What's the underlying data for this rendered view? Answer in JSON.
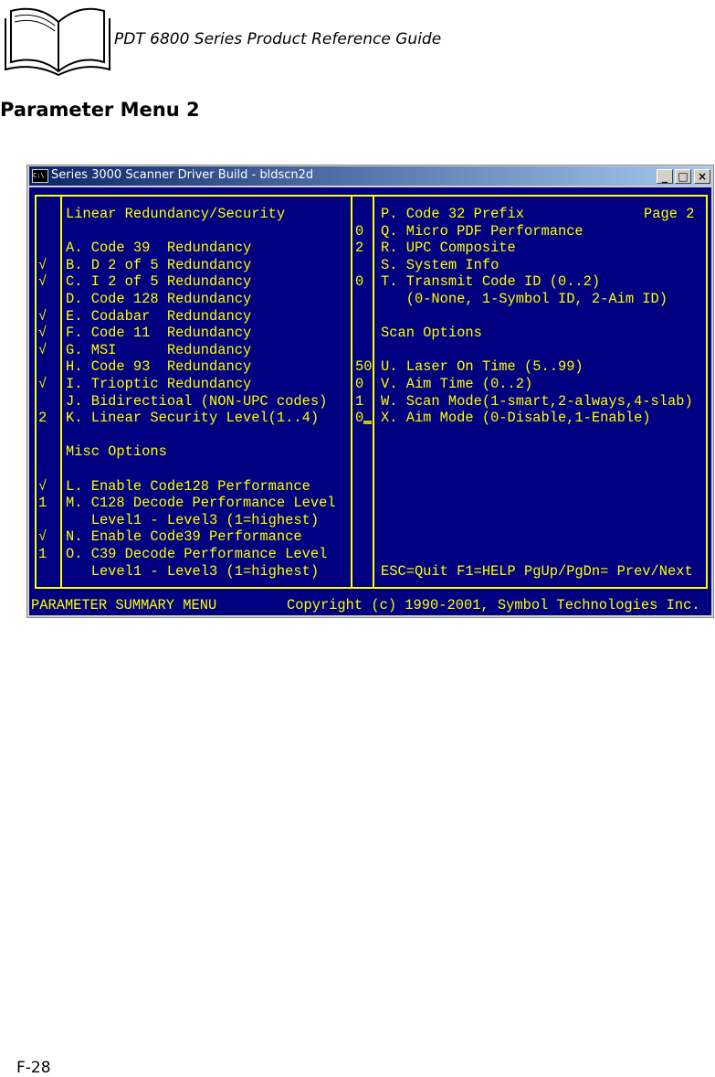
{
  "page": {
    "header": "PDT 6800 Series Product Reference Guide",
    "section_title": "Parameter Menu 2",
    "page_number": "F-28"
  },
  "window": {
    "title": "Series 3000 Scanner Driver Build - bldscn2d",
    "icon_label": "C:\\",
    "buttons": {
      "minimize": "_",
      "maximize": "□",
      "close": "×"
    }
  },
  "console": {
    "rows": [
      {
        "mark": "",
        "left": "Linear Redundancy/Security",
        "value": "",
        "right": "P. Code 32 Prefix",
        "right_extra": "Page 2"
      },
      {
        "mark": "",
        "left": "",
        "value": "0",
        "right": "Q. Micro PDF Performance"
      },
      {
        "mark": "",
        "left": "A. Code 39  Redundancy",
        "value": "2",
        "right": "R. UPC Composite"
      },
      {
        "mark": "√",
        "left": "B. D 2 of 5 Redundancy",
        "value": "",
        "right": "S. System Info"
      },
      {
        "mark": "√",
        "left": "C. I 2 of 5 Redundancy",
        "value": "0",
        "right": "T. Transmit Code ID (0..2)"
      },
      {
        "mark": "",
        "left": "D. Code 128 Redundancy",
        "value": "",
        "right": "   (0-None, 1-Symbol ID, 2-Aim ID)"
      },
      {
        "mark": "√",
        "left": "E. Codabar  Redundancy",
        "value": "",
        "right": ""
      },
      {
        "mark": "√",
        "left": "F. Code 11  Redundancy",
        "value": "",
        "right": "Scan Options"
      },
      {
        "mark": "√",
        "left": "G. MSI      Redundancy",
        "value": "",
        "right": ""
      },
      {
        "mark": "",
        "left": "H. Code 93  Redundancy",
        "value": "50",
        "right": "U. Laser On Time (5..99)"
      },
      {
        "mark": "√",
        "left": "I. Trioptic Redundancy",
        "value": "0",
        "right": "V. Aim Time (0..2)"
      },
      {
        "mark": "",
        "left": "J. Bidirectioal (NON-UPC codes)",
        "value": "1",
        "right": "W. Scan Mode(1-smart,2-always,4-slab)"
      },
      {
        "mark": "2",
        "left": "K. Linear Security Level(1..4)",
        "value": "0",
        "right": "X. Aim Mode (0-Disable,1-Enable)"
      },
      {
        "mark": "",
        "left": "",
        "value": "",
        "right": ""
      },
      {
        "mark": "",
        "left": "Misc Options",
        "value": "",
        "right": ""
      },
      {
        "mark": "",
        "left": "",
        "value": "",
        "right": ""
      },
      {
        "mark": "√",
        "left": "L. Enable Code128 Performance",
        "value": "",
        "right": ""
      },
      {
        "mark": "1",
        "left": "M. C128 Decode Performance Level",
        "value": "",
        "right": ""
      },
      {
        "mark": "",
        "left": "   Level1 - Level3 (1=highest)",
        "value": "",
        "right": ""
      },
      {
        "mark": "√",
        "left": "N. Enable Code39 Performance",
        "value": "",
        "right": ""
      },
      {
        "mark": "1",
        "left": "O. C39 Decode Performance Level",
        "value": "",
        "right": ""
      },
      {
        "mark": "",
        "left": "   Level1 - Level3 (1=highest)",
        "value": "",
        "right": "ESC=Quit F1=HELP PgUp/PgDn= Prev/Next"
      }
    ],
    "status_left": "PARAMETER SUMMARY MENU",
    "status_right": "Copyright (c) 1990-2001, Symbol Technologies Inc."
  },
  "colors": {
    "console_bg": "#000080",
    "console_text": "#ffff00"
  }
}
